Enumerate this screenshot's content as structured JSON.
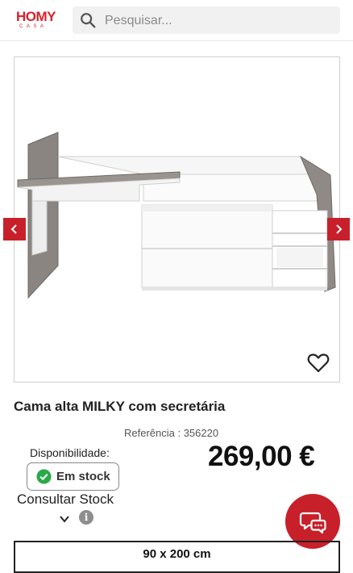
{
  "header": {
    "logo_main": "HOMY",
    "logo_sub": "CASA",
    "search_placeholder": "Pesquisar..."
  },
  "gallery": {
    "image_alt": "Cama alta MILKY com secretária"
  },
  "product": {
    "title": "Cama alta MILKY com secretária",
    "reference_label": "Referência : ",
    "reference_value": "356220",
    "availability_label": "Disponibilidade:",
    "stock_status": "Em stock",
    "price": "269,00 €",
    "consult_stock": "Consultar Stock",
    "size_option": "90 x 200 cm"
  },
  "colors": {
    "brand_red": "#c8202a",
    "stock_green": "#2aa84a"
  },
  "icons": [
    "search-icon",
    "chevron-left-icon",
    "chevron-right-icon",
    "heart-icon",
    "check-circle-icon",
    "chevron-down-icon",
    "info-icon",
    "chat-icon"
  ]
}
